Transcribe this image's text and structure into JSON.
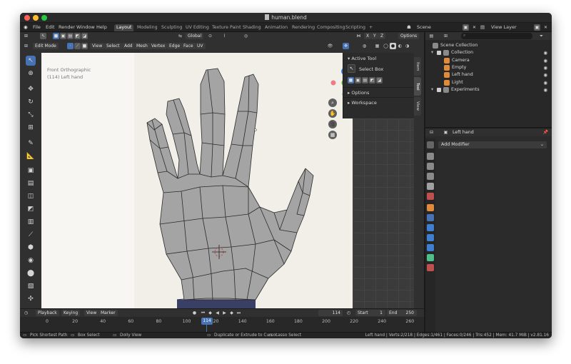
{
  "window": {
    "title": "human.blend",
    "traffic_colors": [
      "#ff5f57",
      "#febc2e",
      "#28c840"
    ]
  },
  "menu": {
    "items": [
      "File",
      "Edit",
      "Render",
      "Window",
      "Help"
    ]
  },
  "workspaces": {
    "active": "Layout",
    "tabs": [
      "Layout",
      "Modeling",
      "Sculpting",
      "UV Editing",
      "Texture Paint",
      "Shading",
      "Animation",
      "Rendering",
      "Compositing",
      "Scripting"
    ],
    "add": "+"
  },
  "scene": {
    "label": "Scene",
    "view_layer": "View Layer"
  },
  "viewport_header": {
    "transform_orientation": "Global",
    "axes": [
      "X",
      "Y",
      "Z"
    ],
    "options": "Options",
    "mode": "Edit Mode",
    "menus": [
      "View",
      "Select",
      "Add",
      "Mesh",
      "Vertex",
      "Edge",
      "Face",
      "UV"
    ]
  },
  "viewport": {
    "view_name": "Front Orthographic",
    "object_info": "(114) Left hand",
    "colors": {
      "mesh": "#a4a4a4",
      "background": "#f1efe8",
      "gizmo_x": "#e84a5f",
      "gizmo_y": "#6ab023",
      "gizmo_z": "#3b7dd8"
    }
  },
  "n_panel": {
    "active_tool_heading": "Active Tool",
    "tool_name": "Select Box",
    "options": "Options",
    "workspace": "Workspace",
    "tabs": [
      "Item",
      "Tool",
      "View"
    ]
  },
  "outliner": {
    "rows": [
      {
        "name": "Scene Collection",
        "indent": 0
      },
      {
        "name": "Collection",
        "indent": 1
      },
      {
        "name": "Camera",
        "indent": 2,
        "icon_color": "#e08a3c"
      },
      {
        "name": "Empty",
        "indent": 2,
        "icon_color": "#e08a3c"
      },
      {
        "name": "Left hand",
        "indent": 2,
        "icon_color": "#e08a3c"
      },
      {
        "name": "Light",
        "indent": 2,
        "icon_color": "#e08a3c"
      },
      {
        "name": "Experiments",
        "indent": 1
      }
    ]
  },
  "properties": {
    "object_name": "Left hand",
    "add_modifier": "Add Modifier"
  },
  "timeline": {
    "menus": [
      "Playback",
      "Keying",
      "View",
      "Marker"
    ],
    "current_frame": "114",
    "start_label": "Start",
    "start": "1",
    "end_label": "End",
    "end": "250",
    "ticks": [
      "0",
      "20",
      "40",
      "60",
      "80",
      "100",
      "120",
      "140",
      "160",
      "180",
      "200",
      "220",
      "240",
      "260"
    ],
    "playhead": "114"
  },
  "status": {
    "left": [
      "Pick Shortest Path",
      "Box Select",
      "Dolly View",
      "Duplicate or Extrude to Cursor",
      "Lasso Select"
    ],
    "stats": "Left hand | Verts:2/218 | Edges:1/461 | Faces:0/246 | Tris:452 | Mem: 41.7 MiB | v2.81.16"
  }
}
